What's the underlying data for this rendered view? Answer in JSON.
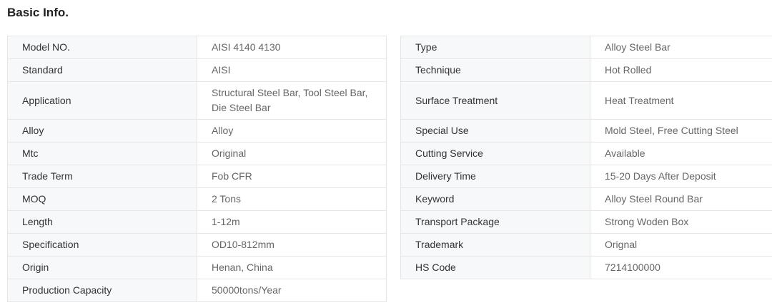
{
  "section": {
    "title": "Basic Info."
  },
  "left_table": [
    {
      "label": "Model NO.",
      "value": "AISI 4140 4130"
    },
    {
      "label": "Standard",
      "value": "AISI"
    },
    {
      "label": "Application",
      "value": "Structural Steel Bar, Tool Steel Bar, Die Steel Bar"
    },
    {
      "label": "Alloy",
      "value": "Alloy"
    },
    {
      "label": "Mtc",
      "value": "Original"
    },
    {
      "label": "Trade Term",
      "value": "Fob CFR"
    },
    {
      "label": "MOQ",
      "value": "2 Tons"
    },
    {
      "label": "Length",
      "value": "1-12m"
    },
    {
      "label": "Specification",
      "value": "OD10-812mm"
    },
    {
      "label": "Origin",
      "value": "Henan, China"
    },
    {
      "label": "Production Capacity",
      "value": "50000tons/Year"
    }
  ],
  "right_table": [
    {
      "label": "Type",
      "value": "Alloy Steel Bar"
    },
    {
      "label": "Technique",
      "value": "Hot Rolled"
    },
    {
      "label": "Surface Treatment",
      "value": "Heat Treatment"
    },
    {
      "label": "Special Use",
      "value": "Mold Steel, Free Cutting Steel"
    },
    {
      "label": "Cutting Service",
      "value": "Available"
    },
    {
      "label": "Delivery Time",
      "value": "15-20 Days After Deposit"
    },
    {
      "label": "Keyword",
      "value": "Alloy Steel Round Bar"
    },
    {
      "label": "Transport Package",
      "value": "Strong Woden Box"
    },
    {
      "label": "Trademark",
      "value": "Orignal"
    },
    {
      "label": "HS Code",
      "value": "7214100000"
    }
  ]
}
